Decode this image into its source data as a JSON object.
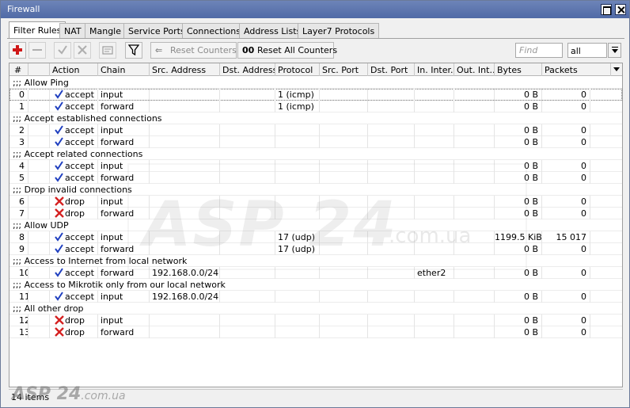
{
  "window": {
    "title": "Firewall"
  },
  "tabs": [
    "Filter Rules",
    "NAT",
    "Mangle",
    "Service Ports",
    "Connections",
    "Address Lists",
    "Layer7 Protocols"
  ],
  "toolbar": {
    "reset_counters": "Reset Counters",
    "reset_all_icon": "00",
    "reset_all_counters": "Reset All Counters",
    "find_placeholder": "Find",
    "filter_value": "all"
  },
  "columns": [
    "#",
    "Action",
    "Chain",
    "Src. Address",
    "Dst. Address",
    "Protocol",
    "Src. Port",
    "Dst. Port",
    "In. Inter...",
    "Out. Int...",
    "Bytes",
    "Packets"
  ],
  "rows": [
    {
      "comment": ";;; Allow Ping"
    },
    {
      "idx": "0",
      "action": "accept",
      "chain": "input",
      "src": "",
      "dst": "",
      "proto": "1 (icmp)",
      "sport": "",
      "dport": "",
      "in": "",
      "out": "",
      "bytes": "0 B",
      "packets": "0"
    },
    {
      "idx": "1",
      "action": "accept",
      "chain": "forward",
      "src": "",
      "dst": "",
      "proto": "1 (icmp)",
      "sport": "",
      "dport": "",
      "in": "",
      "out": "",
      "bytes": "0 B",
      "packets": "0"
    },
    {
      "comment": ";;; Accept established connections"
    },
    {
      "idx": "2",
      "action": "accept",
      "chain": "input",
      "src": "",
      "dst": "",
      "proto": "",
      "sport": "",
      "dport": "",
      "in": "",
      "out": "",
      "bytes": "0 B",
      "packets": "0"
    },
    {
      "idx": "3",
      "action": "accept",
      "chain": "forward",
      "src": "",
      "dst": "",
      "proto": "",
      "sport": "",
      "dport": "",
      "in": "",
      "out": "",
      "bytes": "0 B",
      "packets": "0"
    },
    {
      "comment": ";;; Accept related connections"
    },
    {
      "idx": "4",
      "action": "accept",
      "chain": "input",
      "src": "",
      "dst": "",
      "proto": "",
      "sport": "",
      "dport": "",
      "in": "",
      "out": "",
      "bytes": "0 B",
      "packets": "0"
    },
    {
      "idx": "5",
      "action": "accept",
      "chain": "forward",
      "src": "",
      "dst": "",
      "proto": "",
      "sport": "",
      "dport": "",
      "in": "",
      "out": "",
      "bytes": "0 B",
      "packets": "0"
    },
    {
      "comment": ";;; Drop invalid connections"
    },
    {
      "idx": "6",
      "action": "drop",
      "chain": "input",
      "src": "",
      "dst": "",
      "proto": "",
      "sport": "",
      "dport": "",
      "in": "",
      "out": "",
      "bytes": "0 B",
      "packets": "0"
    },
    {
      "idx": "7",
      "action": "drop",
      "chain": "forward",
      "src": "",
      "dst": "",
      "proto": "",
      "sport": "",
      "dport": "",
      "in": "",
      "out": "",
      "bytes": "0 B",
      "packets": "0"
    },
    {
      "comment": ";;; Allow UDP"
    },
    {
      "idx": "8",
      "action": "accept",
      "chain": "input",
      "src": "",
      "dst": "",
      "proto": "17 (udp)",
      "sport": "",
      "dport": "",
      "in": "",
      "out": "",
      "bytes": "1199.5 KiB",
      "packets": "15 017"
    },
    {
      "idx": "9",
      "action": "accept",
      "chain": "forward",
      "src": "",
      "dst": "",
      "proto": "17 (udp)",
      "sport": "",
      "dport": "",
      "in": "",
      "out": "",
      "bytes": "0 B",
      "packets": "0"
    },
    {
      "comment": ";;; Access to Internet from local network"
    },
    {
      "idx": "10",
      "action": "accept",
      "chain": "forward",
      "src": "192.168.0.0/24",
      "dst": "",
      "proto": "",
      "sport": "",
      "dport": "",
      "in": "ether2",
      "out": "",
      "bytes": "0 B",
      "packets": "0"
    },
    {
      "comment": ";;; Access to Mikrotik only from our local network"
    },
    {
      "idx": "11",
      "action": "accept",
      "chain": "input",
      "src": "192.168.0.0/24",
      "dst": "",
      "proto": "",
      "sport": "",
      "dport": "",
      "in": "",
      "out": "",
      "bytes": "0 B",
      "packets": "0"
    },
    {
      "comment": ";;; All other drop"
    },
    {
      "idx": "12",
      "action": "drop",
      "chain": "input",
      "src": "",
      "dst": "",
      "proto": "",
      "sport": "",
      "dport": "",
      "in": "",
      "out": "",
      "bytes": "0 B",
      "packets": "0"
    },
    {
      "idx": "13",
      "action": "drop",
      "chain": "forward",
      "src": "",
      "dst": "",
      "proto": "",
      "sport": "",
      "dport": "",
      "in": "",
      "out": "",
      "bytes": "0 B",
      "packets": "0"
    }
  ],
  "status": {
    "count": "14 items"
  },
  "watermark": {
    "brand": "ASP 24",
    "domain": ".com.ua"
  },
  "colors": {
    "titlebar": "#5a72ad",
    "accept": "#1f3fbf",
    "drop": "#d42020",
    "add": "#d01818"
  }
}
